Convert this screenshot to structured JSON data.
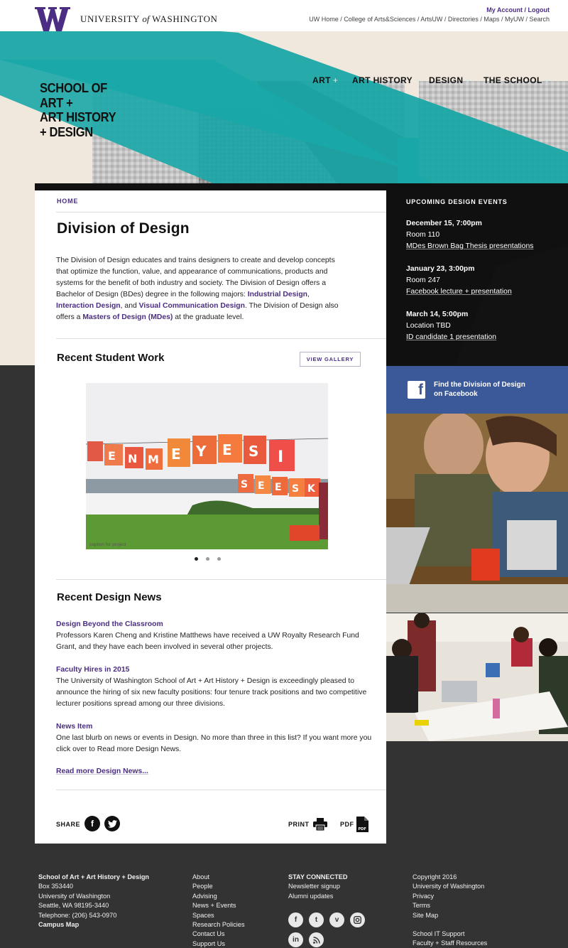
{
  "topbar": {
    "wordmark_pre": "UNIVERSITY",
    "wordmark_of": "of",
    "wordmark_post": "WASHINGTON",
    "my_account": "My Account",
    "logout": "Logout",
    "util_links": [
      "UW Home",
      "College of Arts&Sciences",
      "ArtsUW",
      "Directories",
      "Maps",
      "MyUW",
      "Search"
    ]
  },
  "school_logo": [
    "SCHOOL OF",
    "ART +",
    "ART HISTORY",
    "+ DESIGN"
  ],
  "main_nav": [
    {
      "label": "ART"
    },
    {
      "label": "ART HISTORY"
    },
    {
      "label": "DESIGN"
    },
    {
      "label": "THE SCHOOL"
    }
  ],
  "breadcrumb": "HOME",
  "page_title": "Division of Design",
  "intro": {
    "p1": "The Division of Design educates and trains designers to create and develop concepts that optimize the function, value, and appearance of communications, products and systems for the benefit of both industry and society. The Division of Design offers a Bachelor of Design (BDes) degree in the following majors: ",
    "link1": "Industrial Design",
    "sep1": ", ",
    "link2": "Interaction Design",
    "sep2": ", and ",
    "link3": "Visual Communication Design",
    "p2": ". The Division of Design also offers a ",
    "link4": "Masters of Design (MDes)",
    "p3": " at the graduate level."
  },
  "recent_work": {
    "heading": "Recent Student Work",
    "button": "VIEW GALLERY",
    "caption": "caption for project"
  },
  "news": {
    "heading": "Recent Design News",
    "items": [
      {
        "title": "Design Beyond the Classroom",
        "body": "Professors Karen Cheng and Kristine Matthews have received a UW Royalty Research Fund Grant, and they have each been involved in several other projects."
      },
      {
        "title": "Faculty Hires in 2015",
        "body": "The University of Washington School of Art + Art History + Design is exceedingly pleased to announce the hiring of six new faculty positions: four tenure track positions and two competitive lecturer positions spread among our three divisions."
      },
      {
        "title": "News Item",
        "body": "One last blurb on news or events in Design. No more than three in this list? If you want more you click over to Read more Design News."
      }
    ],
    "read_more": "Read more Design News..."
  },
  "share": {
    "label": "SHARE",
    "print": "PRINT",
    "pdf": "PDF"
  },
  "events": {
    "heading": "UPCOMING DESIGN EVENTS",
    "items": [
      {
        "date": "December 15, 7:00pm",
        "location": "Room 110",
        "title": "MDes Brown Bag Thesis presentations"
      },
      {
        "date": "January 23, 3:00pm",
        "location": "Room 247",
        "title": "Facebook lecture + presentation"
      },
      {
        "date": "March 14, 5:00pm",
        "location": "Location TBD",
        "title": "ID candidate 1 presentation"
      }
    ]
  },
  "facebook": {
    "line1": "Find the Division of Design",
    "line2": "on Facebook"
  },
  "footer": {
    "address": {
      "name": "School of Art + Art History + Design",
      "box": "Box 353440",
      "uni": "University of Washington",
      "city": "Seattle, WA 98195-3440",
      "phone": "Telephone: (206) 543-0970",
      "map": "Campus Map"
    },
    "nav": [
      "About",
      "People",
      "Advising",
      "News + Events",
      "Spaces",
      "Research Policies",
      "Contact Us",
      "Support Us"
    ],
    "stay_connected": {
      "heading": "STAY CONNECTED",
      "items": [
        "Newsletter signup",
        "Alumni updates"
      ]
    },
    "legal": [
      "Copyright 2016",
      "University of Washington",
      "Privacy",
      "Terms",
      "Site Map"
    ],
    "support": [
      "School IT Support",
      "Faculty + Staff Resources"
    ]
  },
  "colors": {
    "uw_purple": "#4b2e83",
    "teal": "#1aa7a7",
    "facebook_blue": "#3b5998",
    "footer_bg": "#333333"
  }
}
